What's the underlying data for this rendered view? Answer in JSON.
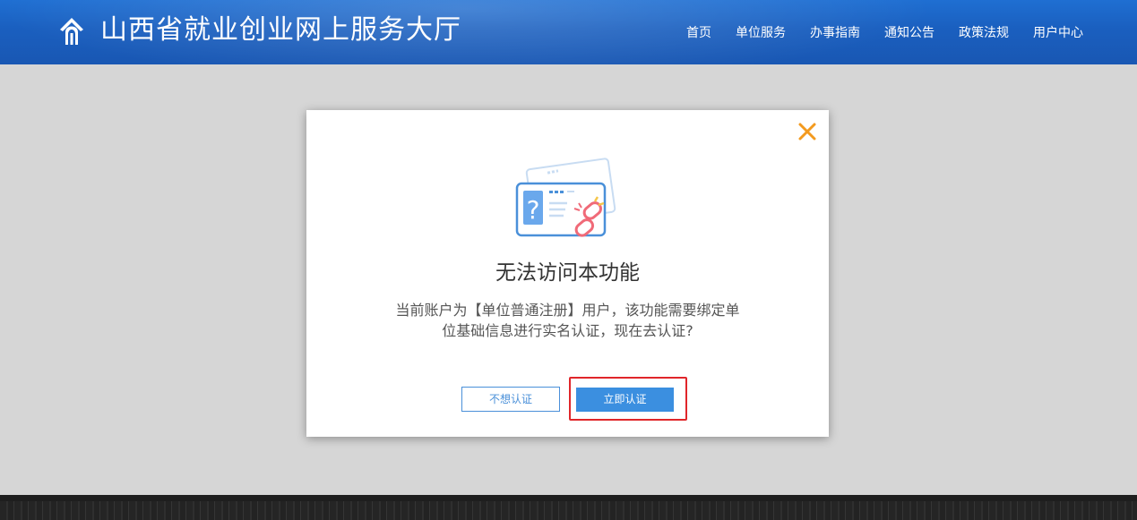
{
  "header": {
    "logo_icon": "ornamental-roof-logo-icon",
    "site_title": "山西省就业创业网上服务大厅",
    "background_color": "#1a5fbf",
    "nav": [
      {
        "label": "首页",
        "name": "nav-home"
      },
      {
        "label": "单位服务",
        "name": "nav-unit-service"
      },
      {
        "label": "办事指南",
        "name": "nav-guide"
      },
      {
        "label": "通知公告",
        "name": "nav-notice"
      },
      {
        "label": "政策法规",
        "name": "nav-policy"
      },
      {
        "label": "用户中心",
        "name": "nav-user-center"
      }
    ]
  },
  "modal": {
    "close_icon": "close-icon",
    "close_color": "#f39a1e",
    "illustration_icon": "broken-link-id-card-icon",
    "title": "无法访问本功能",
    "message_line1": "当前账户为【单位普通注册】用户，该功能需要绑定单",
    "message_line2": "位基础信息进行实名认证，现在去认证?",
    "cancel_label": "不想认证",
    "confirm_label": "立即认证",
    "accent_color": "#3b8fe0",
    "highlight_color": "#e0262a"
  },
  "overlay_color": "#d6d6d6"
}
